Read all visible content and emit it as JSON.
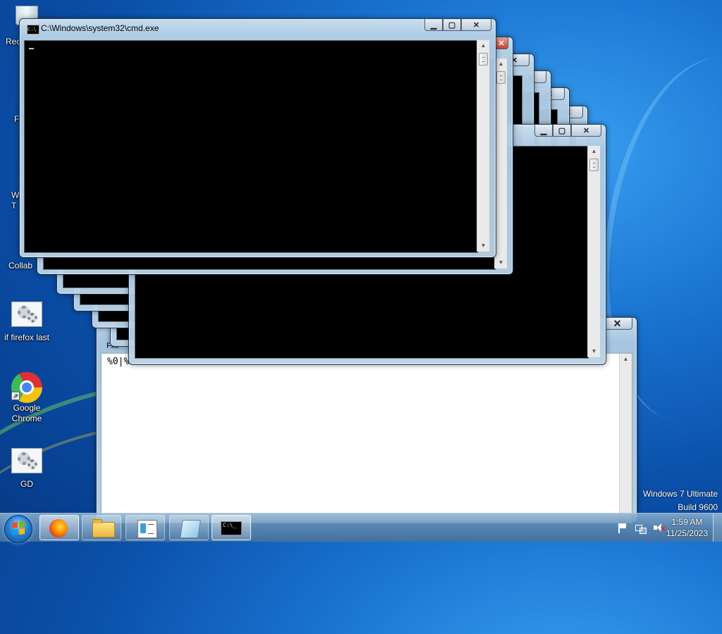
{
  "desktop": {
    "icons": [
      {
        "id": "recycle",
        "label": "Rec"
      },
      {
        "id": "ff-edge",
        "label": "F"
      },
      {
        "id": "w-edge",
        "label": "W\nT"
      },
      {
        "id": "collab",
        "label": "Collab"
      },
      {
        "id": "if-firefox-last",
        "label": "if firefox last"
      },
      {
        "id": "google-chrome",
        "label": "Google Chrome"
      },
      {
        "id": "gd",
        "label": "GD"
      }
    ],
    "watermark": {
      "line1": "Windows 7 Ultimate",
      "line2": "Build 9600"
    }
  },
  "windows": {
    "cmd_front": {
      "title": "C:\\Windows\\system32\\cmd.exe"
    },
    "notepad": {
      "menu_file": "File",
      "text": "%0|%"
    }
  },
  "taskbar": {
    "tray": {
      "time": "1:59 AM",
      "date": "11/25/2023"
    },
    "cmd_label": "C:\\_"
  },
  "colors": {
    "console_bg": "#000000",
    "close_red": "#c7432f",
    "wallpaper": "#1b76d4"
  }
}
